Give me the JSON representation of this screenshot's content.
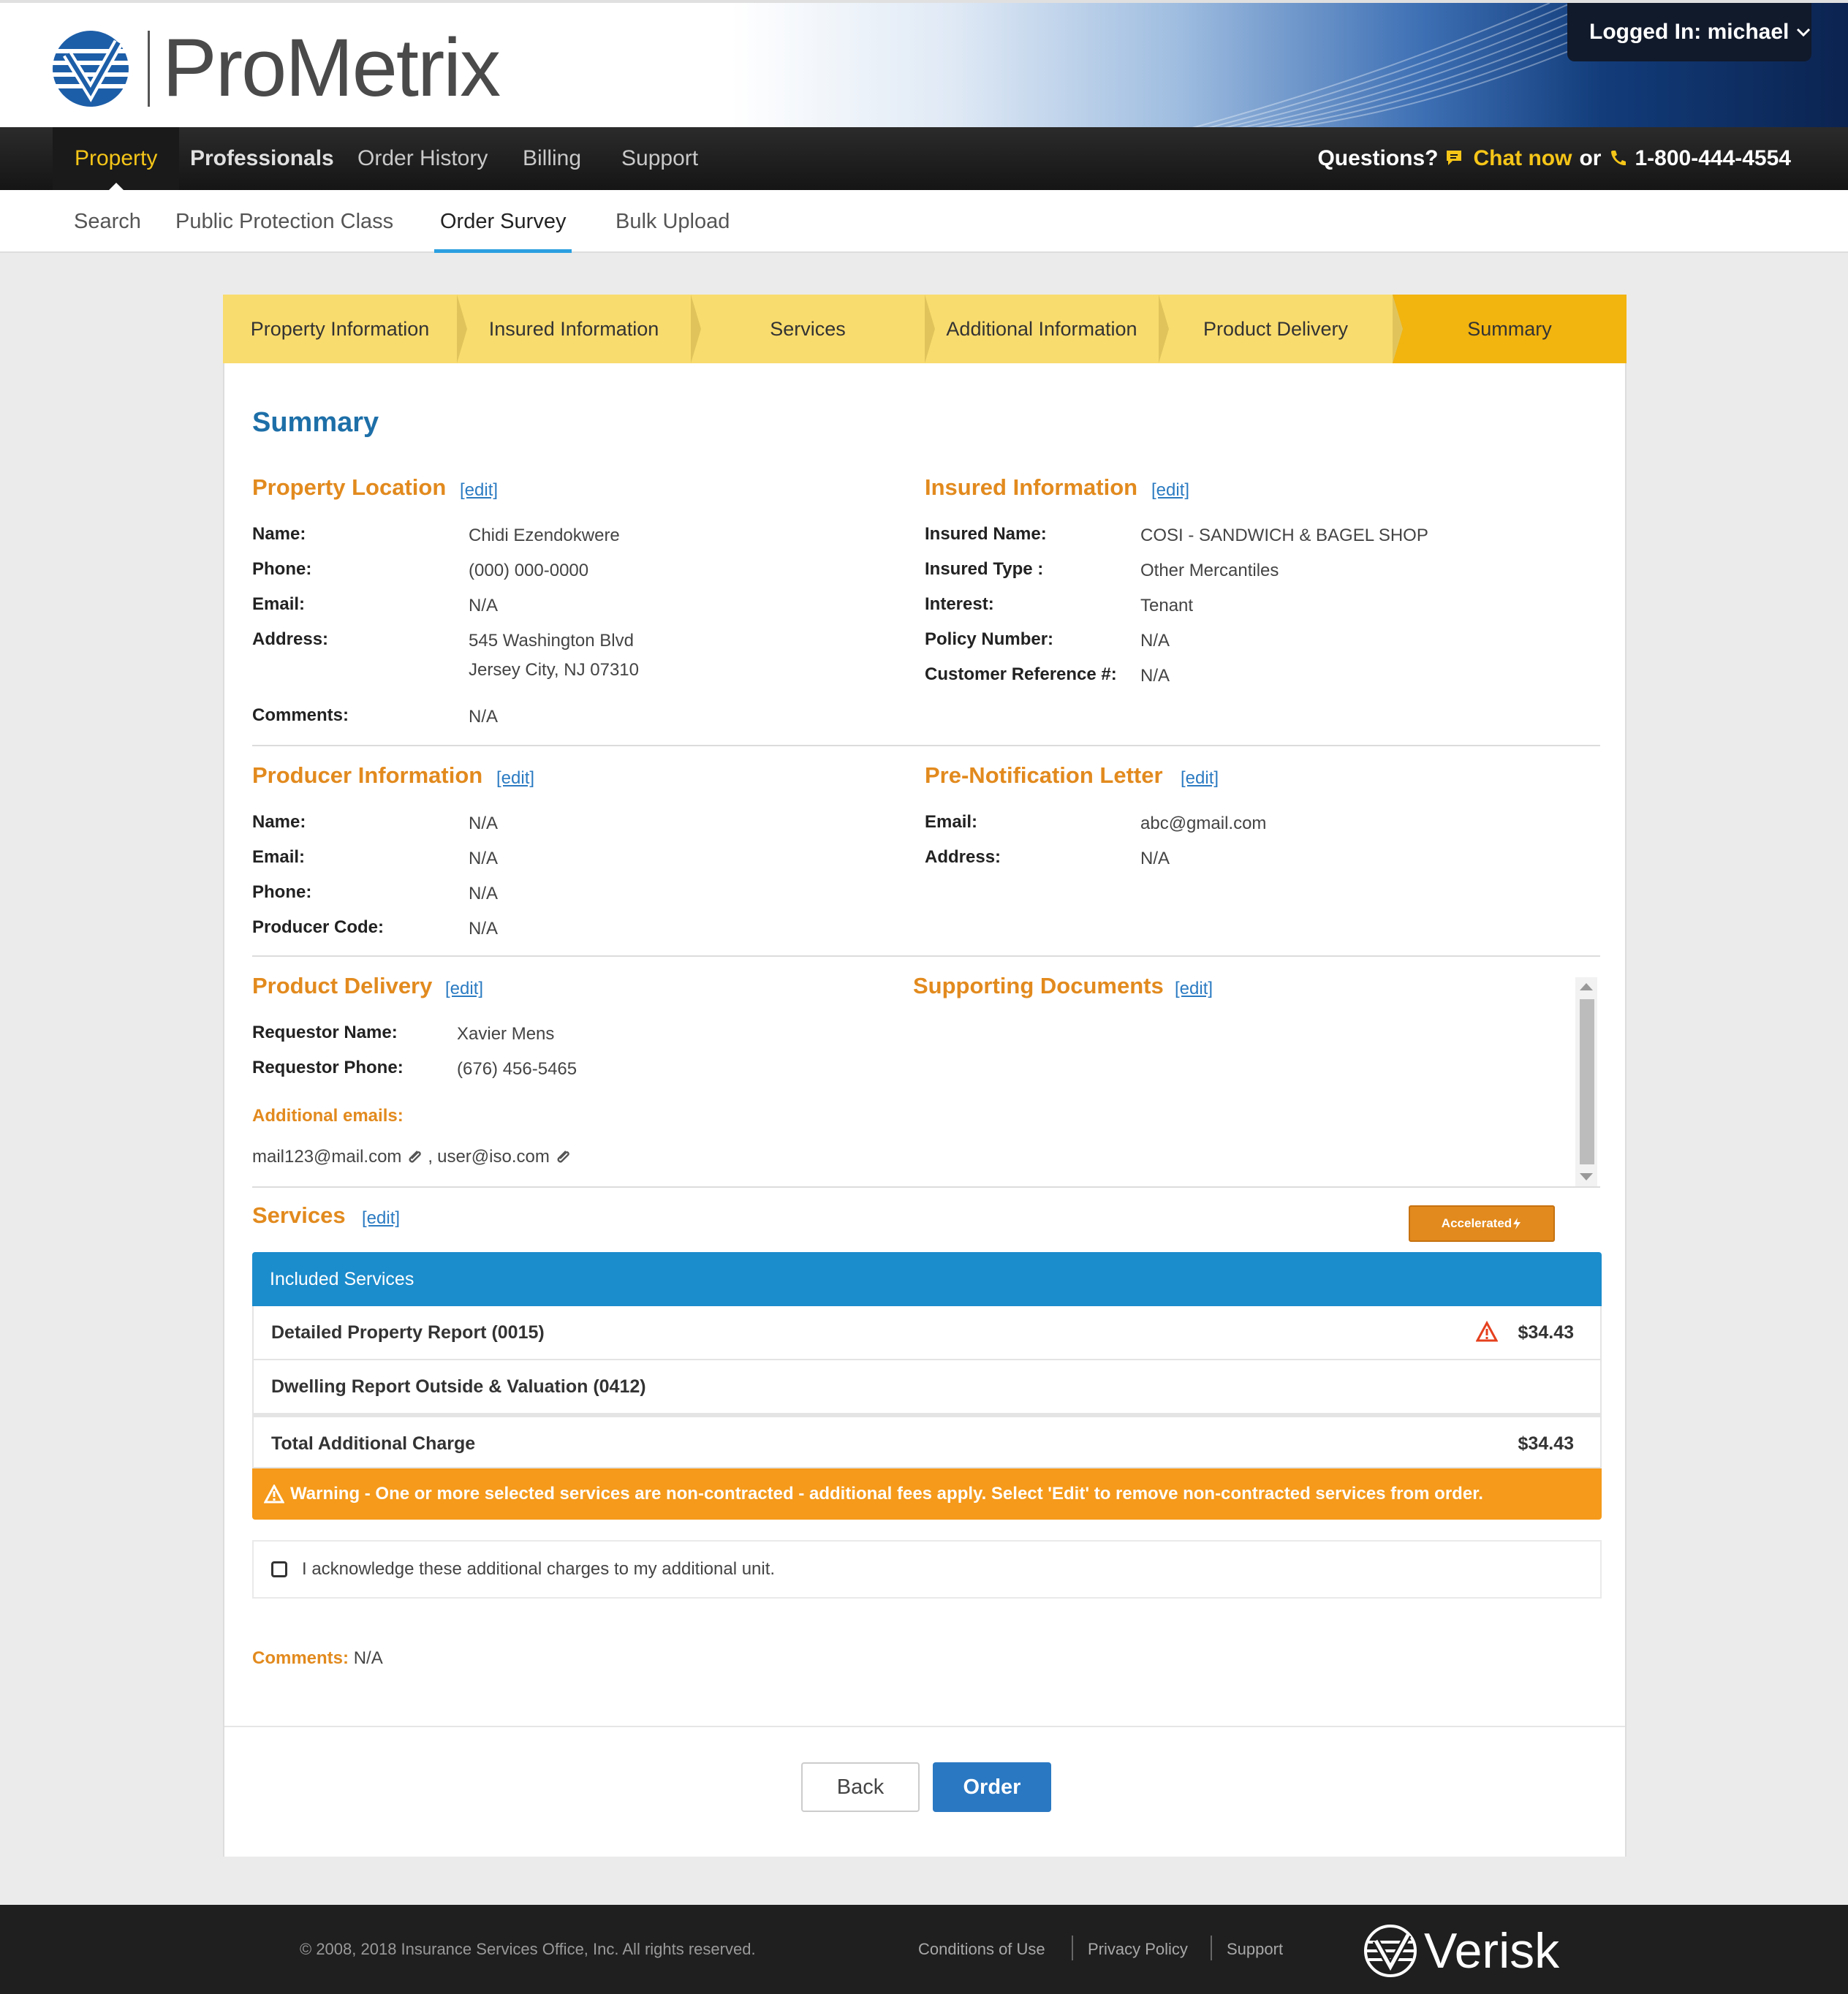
{
  "header": {
    "logo_text": "ProMetrix",
    "logged_in": "Logged In: michael"
  },
  "mainnav": {
    "items": [
      {
        "label": "Property"
      },
      {
        "label": "Professionals"
      },
      {
        "label": "Order History"
      },
      {
        "label": "Billing"
      },
      {
        "label": "Support"
      }
    ],
    "questions": "Questions?",
    "chat": "Chat now",
    "or": "or",
    "phone": "1-800-444-4554"
  },
  "subnav": {
    "items": [
      {
        "label": "Search"
      },
      {
        "label": "Public Protection Class"
      },
      {
        "label": "Order Survey"
      },
      {
        "label": "Bulk Upload"
      }
    ]
  },
  "stepper": {
    "steps": [
      {
        "label": "Property Information"
      },
      {
        "label": "Insured Information"
      },
      {
        "label": "Services"
      },
      {
        "label": "Additional Information"
      },
      {
        "label": "Product Delivery"
      },
      {
        "label": "Summary"
      }
    ]
  },
  "summary": {
    "title": "Summary",
    "edit_label": "[edit]",
    "property_location": {
      "title": "Property Location",
      "name_label": "Name:",
      "name": "Chidi Ezendokwere",
      "phone_label": "Phone:",
      "phone": "(000) 000-0000",
      "email_label": "Email:",
      "email": "N/A",
      "address_label": "Address:",
      "address_line1": "545 Washington Blvd",
      "address_line2": "Jersey City, NJ 07310",
      "comments_label": "Comments:",
      "comments": "N/A"
    },
    "insured_information": {
      "title": "Insured Information",
      "insured_name_label": "Insured Name:",
      "insured_name": "COSI - SANDWICH & BAGEL SHOP",
      "insured_type_label": "Insured Type :",
      "insured_type": "Other Mercantiles",
      "interest_label": "Interest:",
      "interest": "Tenant",
      "policy_label": "Policy Number:",
      "policy": "N/A",
      "customer_ref_label": "Customer Reference #:",
      "customer_ref": "N/A"
    },
    "producer_information": {
      "title": "Producer Information",
      "name_label": "Name:",
      "name": "N/A",
      "email_label": "Email:",
      "email": "N/A",
      "phone_label": "Phone:",
      "phone": "N/A",
      "code_label": "Producer Code:",
      "code": "N/A"
    },
    "pre_notification": {
      "title": "Pre-Notification Letter",
      "email_label": "Email:",
      "email": "abc@gmail.com",
      "address_label": "Address:",
      "address": "N/A"
    },
    "product_delivery": {
      "title": "Product Delivery",
      "req_name_label": "Requestor Name:",
      "req_name": "Xavier Mens",
      "req_phone_label": "Requestor Phone:",
      "req_phone": "(676) 456-5465",
      "additional_emails_label": "Additional emails:",
      "email1": "mail123@mail.com",
      "sep": ",",
      "email2": "user@iso.com"
    },
    "supporting_documents": {
      "title": "Supporting Documents"
    },
    "services": {
      "title": "Services",
      "accelerated_label": "Accelerated",
      "table_header": "Included Services",
      "rows": [
        {
          "name": "Detailed Property Report (0015)",
          "price": "$34.43",
          "warning": true
        },
        {
          "name": "Dwelling Report Outside & Valuation (0412)",
          "price": ""
        }
      ],
      "total_label": "Total Additional Charge",
      "total": "$34.43",
      "warning": "Warning - One or more selected services are non-contracted - additional fees apply. Select 'Edit' to remove non-contracted services from order."
    },
    "acknowledge": "I acknowledge these additional charges to my additional unit.",
    "comments_label": "Comments:",
    "comments": "N/A",
    "back_label": "Back",
    "order_label": "Order"
  },
  "footer": {
    "copyright": "© 2008, 2018 Insurance Services Office, Inc. All rights reserved.",
    "links": [
      {
        "label": "Conditions of Use"
      },
      {
        "label": "Privacy Policy"
      },
      {
        "label": "Support"
      }
    ],
    "brand": "Verisk"
  },
  "colors": {
    "accent_orange": "#e28a1e",
    "title_blue": "#1d6fa8",
    "table_header_blue": "#1b8ccc",
    "step_yellow": "#f9dc6e",
    "step_active": "#f2b40f",
    "warning_orange": "#f59a1b",
    "order_blue": "#2a78c2"
  }
}
